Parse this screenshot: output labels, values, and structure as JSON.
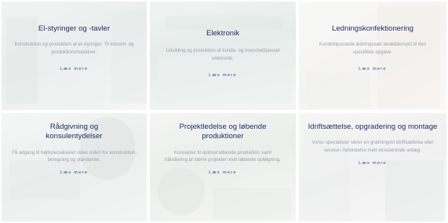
{
  "cards": [
    {
      "title": "El-styringer og -tavler",
      "description": "Konstruktion og produktion af el-styringer. Til industri- og produktionsmaskiner.",
      "link": "Læs mere"
    },
    {
      "title": "Elektronik",
      "description": "Udvikling og produktion af kunde- og branchetilpasset elektronik.",
      "link": "Læs mere"
    },
    {
      "title": "Ledningskonfektionering",
      "description": "Kundetilpassede ledningssæt skræddersyet til den specifikke opgave.",
      "link": "Læs mere"
    },
    {
      "title": "Rådgivning og konsulentydelser",
      "description": "Få adgang til højtspecialiseret viden inden for konstruktion, beregning og standarder.",
      "link": "Læs mere"
    },
    {
      "title": "Projektledelse og løbende produktioner",
      "description": "Koncepter til optimal løbende produktion samt håndtering af større projekter med løbende opfølgning.",
      "link": "Læs mere"
    },
    {
      "title": "Idriftsættelse, opgradering og montage",
      "description": "Vores specialister sikrer en gnidningsfri idriftsættelse eller service i forbindelse med eksisterende anlæg.",
      "link": "Læs mere"
    }
  ],
  "colors": {
    "title": "#1f2e63",
    "description": "#9aa0ad",
    "link": "#3a4d8f"
  }
}
